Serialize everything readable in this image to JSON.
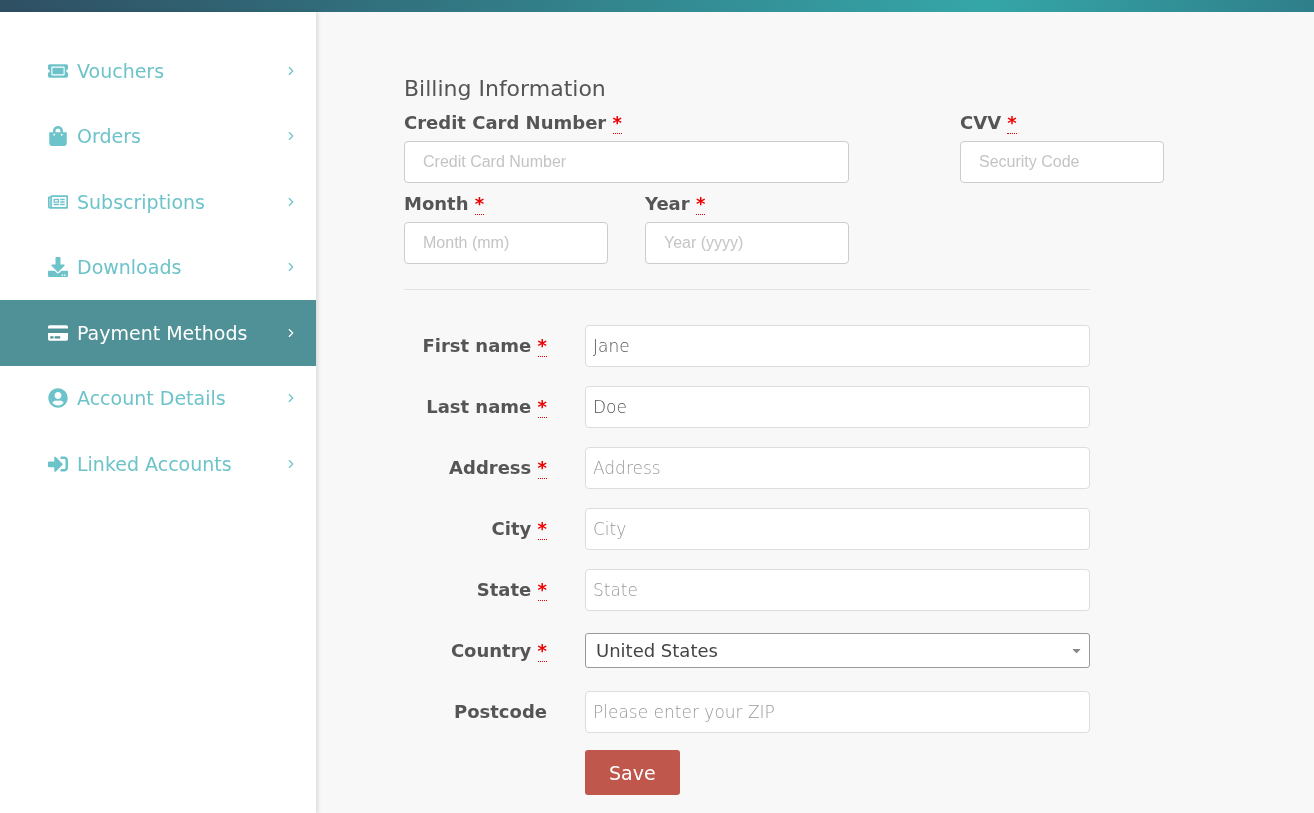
{
  "sidebar": {
    "items": [
      {
        "label": "Vouchers",
        "selected": false
      },
      {
        "label": "Orders",
        "selected": false
      },
      {
        "label": "Subscriptions",
        "selected": false
      },
      {
        "label": "Downloads",
        "selected": false
      },
      {
        "label": "Payment Methods",
        "selected": true
      },
      {
        "label": "Account Details",
        "selected": false
      },
      {
        "label": "Linked Accounts",
        "selected": false
      }
    ]
  },
  "billing": {
    "title": "Billing Information",
    "card_fields": [
      {
        "label": "Credit Card Number",
        "mark": "*",
        "placeholder": "Credit Card Number"
      },
      {
        "label": "CVV",
        "mark": "*",
        "placeholder": "Security Code"
      },
      {
        "label": "Month",
        "mark": "*",
        "placeholder": "Month (mm)"
      },
      {
        "label": "Year",
        "mark": "*",
        "placeholder": "Year (yyyy)"
      }
    ],
    "address_fields": [
      {
        "kind": "text",
        "label": "First name",
        "mark": "*",
        "value": "Jane"
      },
      {
        "kind": "text",
        "label": "Last name",
        "mark": "*",
        "value": "Doe"
      },
      {
        "kind": "text",
        "label": "Address",
        "mark": "*",
        "placeholder": "Address"
      },
      {
        "kind": "text",
        "label": "City",
        "mark": "*",
        "placeholder": "City"
      },
      {
        "kind": "text",
        "label": "State",
        "mark": "*",
        "placeholder": "State"
      },
      {
        "kind": "select",
        "label": "Country",
        "mark": "*",
        "value": "United States"
      },
      {
        "kind": "text",
        "label": "Postcode",
        "placeholder": "Please enter your ZIP"
      }
    ],
    "save_button": "Save"
  }
}
